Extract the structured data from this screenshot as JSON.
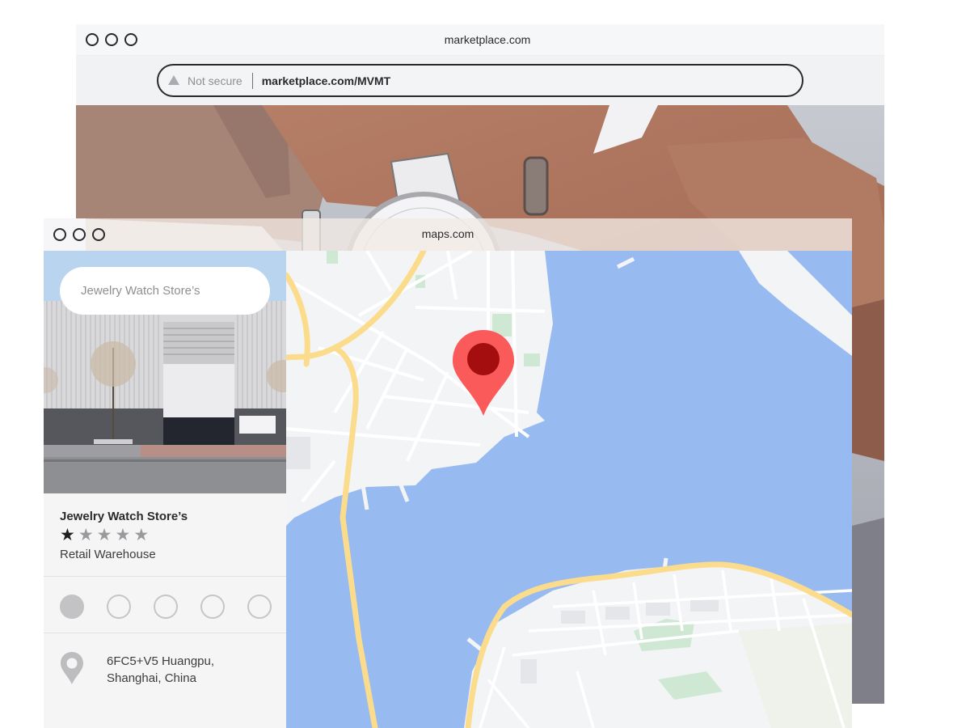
{
  "back_window": {
    "title": "marketplace.com",
    "security_label": "Not secure",
    "url": "marketplace.com/MVMT",
    "hero_image": "Wrist wearing a white-faced watch with white leather strap and a ring"
  },
  "front_window": {
    "title": "maps.com",
    "search": {
      "value": "Jewelry Watch Store’s"
    },
    "place": {
      "name": "Jewelry Watch Store’s",
      "rating": 1,
      "rating_max": 5,
      "category": "Retail Warehouse",
      "photo": "Warehouse storefront with grey corrugated facade and trees",
      "address_line1": "6FC5+V5 Huangpu,",
      "address_line2": "Shanghai, China"
    },
    "photo_dots": {
      "count": 5,
      "active_index": 0
    },
    "map": {
      "marker_icon": "map-pin-icon",
      "colors": {
        "water": "#97baf1",
        "land": "#f3f4f6",
        "road_major": "#fbdc8c",
        "park": "#cfe8d3",
        "marker": "#fa5a5a",
        "marker_center": "#a50e0e"
      }
    }
  },
  "icons": {
    "window_controls": "traffic-light-circle-icon",
    "security": "warning-triangle-icon",
    "star": "star-icon",
    "address": "location-pin-icon"
  }
}
